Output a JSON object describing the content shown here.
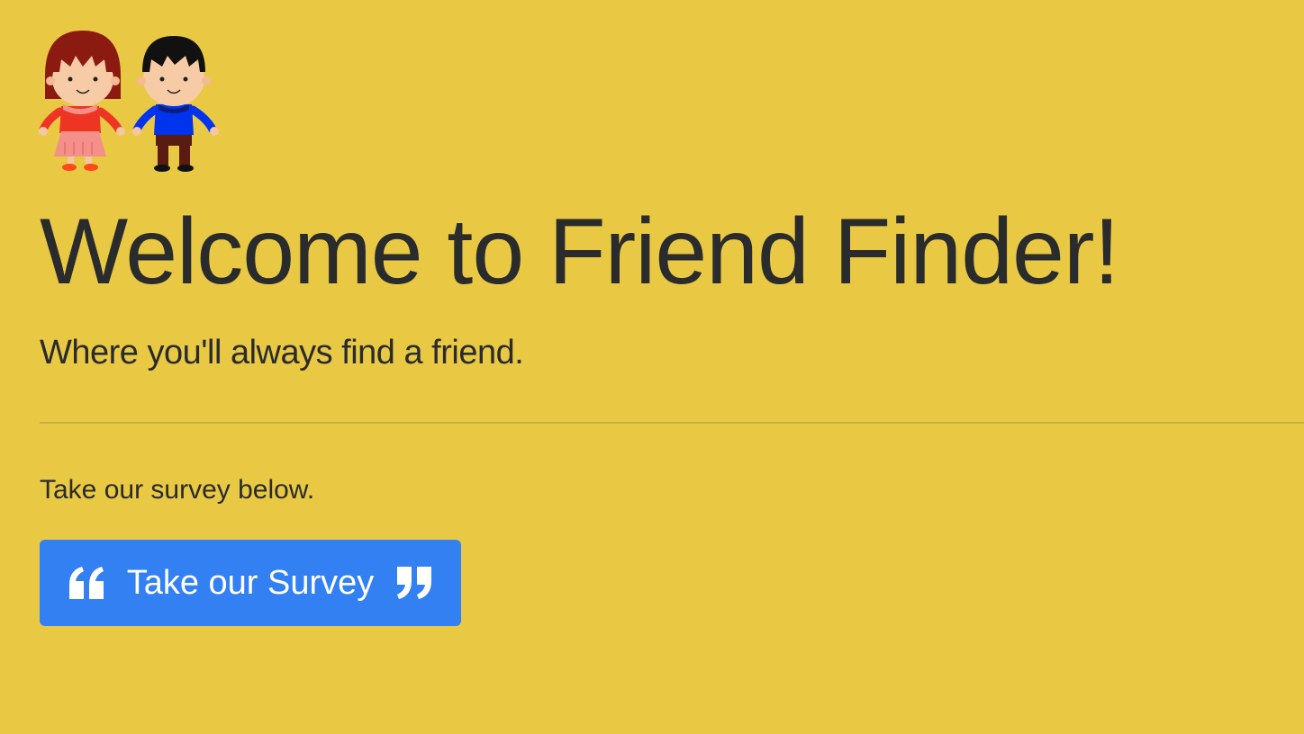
{
  "colors": {
    "page_background": "#E9C844",
    "button_background": "#3380F3",
    "button_text": "#FFFFFF"
  },
  "hero": {
    "logo_icon": "two-kids-icon",
    "title": "Welcome to Friend Finder!",
    "tagline": "Where you'll always find a friend."
  },
  "survey": {
    "intro_text": "Take our survey below.",
    "button_label": "Take our Survey",
    "left_icon": "quote-left-icon",
    "right_icon": "quote-right-icon"
  }
}
